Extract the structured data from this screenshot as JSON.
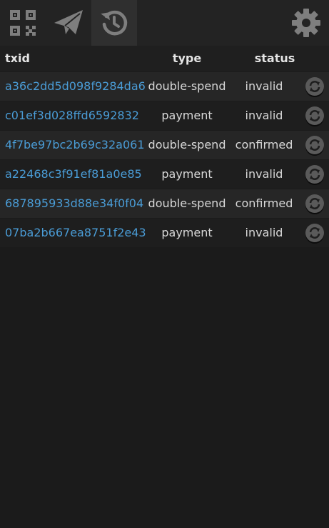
{
  "toolbar": {
    "buttons": [
      {
        "icon": "qr-code-icon",
        "active": false
      },
      {
        "icon": "send-plane-icon",
        "active": false
      },
      {
        "icon": "history-icon",
        "active": true
      },
      {
        "icon": "gear-icon",
        "active": false
      }
    ],
    "icon_color": "#7e7e7e",
    "active_bg": "#2f2f2f"
  },
  "table": {
    "headers": {
      "txid": "txid",
      "type": "type",
      "status": "status"
    },
    "rows": [
      {
        "txid": "a36c2dd5d098f9284da6",
        "type": "double-spend",
        "status": "invalid"
      },
      {
        "txid": "c01ef3d028ffd6592832",
        "type": "payment",
        "status": "invalid"
      },
      {
        "txid": "4f7be97bc2b69c32a061",
        "type": "double-spend",
        "status": "confirmed"
      },
      {
        "txid": "a22468c3f91ef81a0e85",
        "type": "payment",
        "status": "invalid"
      },
      {
        "txid": "687895933d88e34f0f04",
        "type": "double-spend",
        "status": "confirmed"
      },
      {
        "txid": "07ba2b667ea8751f2e43",
        "type": "payment",
        "status": "invalid"
      }
    ],
    "link_color": "#4a9cd6"
  }
}
